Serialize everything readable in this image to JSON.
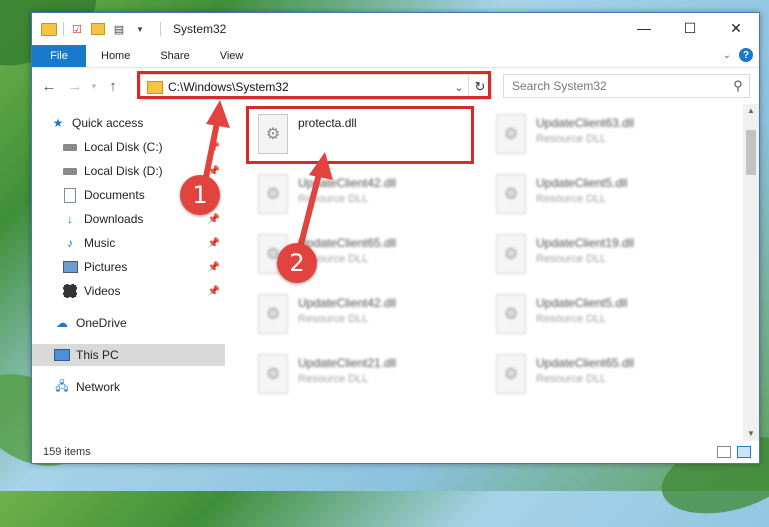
{
  "window": {
    "title": "System32",
    "controls": {
      "minimize": "—",
      "maximize": "☐",
      "close": "✕"
    }
  },
  "ribbon": {
    "tabs": [
      {
        "label": "File"
      },
      {
        "label": "Home"
      },
      {
        "label": "Share"
      },
      {
        "label": "View"
      }
    ]
  },
  "address": {
    "path": "C:\\Windows\\System32",
    "search_placeholder": "Search System32"
  },
  "navpane": {
    "items": [
      {
        "label": "Quick access",
        "icon": "star-icon"
      },
      {
        "label": "Local Disk (C:)",
        "icon": "drive-icon",
        "pinned": true
      },
      {
        "label": "Local Disk (D:)",
        "icon": "drive-icon",
        "pinned": true
      },
      {
        "label": "Documents",
        "icon": "document-icon",
        "pinned": true
      },
      {
        "label": "Downloads",
        "icon": "download-icon",
        "pinned": true
      },
      {
        "label": "Music",
        "icon": "music-icon",
        "pinned": true
      },
      {
        "label": "Pictures",
        "icon": "picture-icon",
        "pinned": true
      },
      {
        "label": "Videos",
        "icon": "video-icon",
        "pinned": true
      },
      {
        "label": "OneDrive",
        "icon": "cloud-icon"
      },
      {
        "label": "This PC",
        "icon": "computer-icon",
        "selected": true
      },
      {
        "label": "Network",
        "icon": "network-icon"
      }
    ]
  },
  "files": [
    {
      "name": "protecta.dll",
      "type": ""
    },
    {
      "name": "UpdateClient63.dll",
      "type": "Resource DLL"
    },
    {
      "name": "UpdateClient42.dll",
      "type": "Resource DLL"
    },
    {
      "name": "UpdateClient5.dll",
      "type": "Resource DLL"
    },
    {
      "name": "UpdateClient65.dll",
      "type": "Resource DLL"
    },
    {
      "name": "UpdateClient19.dll",
      "type": "Resource DLL"
    },
    {
      "name": "UpdateClient42.dll",
      "type": "Resource DLL"
    },
    {
      "name": "UpdateClient5.dll",
      "type": "Resource DLL"
    },
    {
      "name": "UpdateClient21.dll",
      "type": "Resource DLL"
    },
    {
      "name": "UpdateClient65.dll",
      "type": "Resource DLL"
    }
  ],
  "status": {
    "item_count": "159 items"
  },
  "annotations": {
    "step1": "1",
    "step2": "2",
    "color": "#e2433f"
  }
}
